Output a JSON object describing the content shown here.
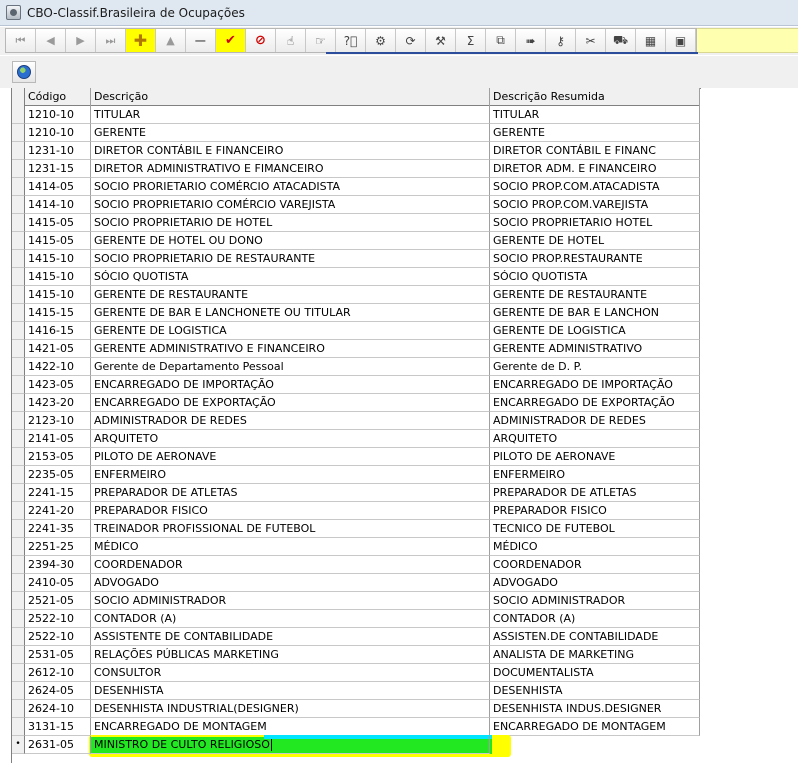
{
  "window": {
    "title": "CBO-Classif.Brasileira de Ocupações"
  },
  "toolbar": {
    "buttons": [
      {
        "icon": "first-record-icon",
        "glyph": "⏮",
        "cls": "nav"
      },
      {
        "icon": "prior-record-icon",
        "glyph": "◀",
        "cls": "nav"
      },
      {
        "icon": "next-record-icon",
        "glyph": "▶",
        "cls": "nav"
      },
      {
        "icon": "last-record-icon",
        "glyph": "⏭",
        "cls": "nav"
      },
      {
        "icon": "insert-record-icon",
        "glyph": "✚",
        "cls": "plus",
        "highlight": true
      },
      {
        "icon": "up-icon",
        "glyph": "▲",
        "cls": "nav"
      },
      {
        "icon": "delete-record-icon",
        "glyph": "−",
        "cls": "minus"
      },
      {
        "icon": "post-record-icon",
        "glyph": "✔",
        "cls": "red",
        "highlight": true
      },
      {
        "icon": "cancel-edit-icon",
        "glyph": "⊘",
        "cls": "red"
      },
      {
        "icon": "hand-pointer-icon",
        "glyph": "☝",
        "cls": "grey"
      },
      {
        "icon": "goto-record-icon",
        "glyph": "☞",
        "cls": "grey"
      },
      {
        "icon": "search-help-icon",
        "glyph": "?⃞",
        "cls": "grey"
      },
      {
        "icon": "filter-icon",
        "glyph": "⚙",
        "cls": "grey"
      },
      {
        "icon": "refresh-icon",
        "glyph": "⟳",
        "cls": "grey"
      },
      {
        "icon": "settings-icon",
        "glyph": "⚒",
        "cls": "grey"
      },
      {
        "icon": "sum-icon",
        "glyph": "Σ",
        "cls": "grey"
      },
      {
        "icon": "copy-icon",
        "glyph": "⧉",
        "cls": "grey"
      },
      {
        "icon": "export-icon",
        "glyph": "➠",
        "cls": "grey"
      },
      {
        "icon": "key-icon",
        "glyph": "⚷",
        "cls": "grey"
      },
      {
        "icon": "tools-icon",
        "glyph": "✂",
        "cls": "grey"
      },
      {
        "icon": "vehicle-icon",
        "glyph": "⛟",
        "cls": "grey"
      },
      {
        "icon": "calendar-icon",
        "glyph": "▦",
        "cls": "grey"
      },
      {
        "icon": "stop-icon",
        "glyph": "▣",
        "cls": "grey"
      }
    ]
  },
  "grid": {
    "headers": {
      "codigo": "Código",
      "descricao": "Descrição",
      "resumida": "Descrição Resumida"
    },
    "rows": [
      {
        "codigo": "1210-10",
        "descricao": "TITULAR",
        "resumida": "TITULAR"
      },
      {
        "codigo": "1210-10",
        "descricao": "GERENTE",
        "resumida": "GERENTE"
      },
      {
        "codigo": "1231-10",
        "descricao": "DIRETOR CONTÁBIL E FINANCEIRO",
        "resumida": "DIRETOR CONTÁBIL E FINANC"
      },
      {
        "codigo": "1231-15",
        "descricao": "DIRETOR ADMINISTRATIVO E FIMANCEIRO",
        "resumida": "DIRETOR ADM. E FINANCEIRO"
      },
      {
        "codigo": "1414-05",
        "descricao": "SOCIO PRORIETARIO COMÉRCIO ATACADISTA",
        "resumida": "SOCIO PROP.COM.ATACADISTA"
      },
      {
        "codigo": "1414-10",
        "descricao": "SOCIO PROPRIETARIO COMÉRCIO VAREJISTA",
        "resumida": "SOCIO PROP.COM.VAREJISTA"
      },
      {
        "codigo": "1415-05",
        "descricao": "SOCIO PROPRIETARIO DE HOTEL",
        "resumida": "SOCIO PROPRIETARIO  HOTEL"
      },
      {
        "codigo": "1415-05",
        "descricao": "GERENTE DE HOTEL OU DONO",
        "resumida": "GERENTE DE HOTEL"
      },
      {
        "codigo": "1415-10",
        "descricao": "SOCIO PROPRIETARIO DE RESTAURANTE",
        "resumida": "SOCIO PROP.RESTAURANTE"
      },
      {
        "codigo": "1415-10",
        "descricao": "SÓCIO QUOTISTA",
        "resumida": "SÓCIO QUOTISTA"
      },
      {
        "codigo": "1415-10",
        "descricao": "GERENTE DE RESTAURANTE",
        "resumida": "GERENTE DE RESTAURANTE"
      },
      {
        "codigo": "1415-15",
        "descricao": "GERENTE DE BAR E LANCHONETE OU TITULAR",
        "resumida": "GERENTE DE BAR E LANCHON"
      },
      {
        "codigo": "1416-15",
        "descricao": "GERENTE DE LOGISTICA",
        "resumida": "GERENTE DE LOGISTICA"
      },
      {
        "codigo": "1421-05",
        "descricao": "GERENTE ADMINISTRATIVO E FINANCEIRO",
        "resumida": "GERENTE ADMINISTRATIVO"
      },
      {
        "codigo": "1422-10",
        "descricao": "Gerente de Departamento Pessoal",
        "resumida": "Gerente de D. P."
      },
      {
        "codigo": "1423-05",
        "descricao": "ENCARREGADO DE IMPORTAÇÃO",
        "resumida": "ENCARREGADO DE IMPORTAÇÃO"
      },
      {
        "codigo": "1423-20",
        "descricao": "ENCARREGADO DE EXPORTAÇÃO",
        "resumida": "ENCARREGADO DE EXPORTAÇÃO"
      },
      {
        "codigo": "2123-10",
        "descricao": "ADMINISTRADOR DE REDES",
        "resumida": "ADMINISTRADOR DE REDES"
      },
      {
        "codigo": "2141-05",
        "descricao": "ARQUITETO",
        "resumida": "ARQUITETO"
      },
      {
        "codigo": "2153-05",
        "descricao": "PILOTO DE AERONAVE",
        "resumida": "PILOTO DE AERONAVE"
      },
      {
        "codigo": "2235-05",
        "descricao": "ENFERMEIRO",
        "resumida": "ENFERMEIRO"
      },
      {
        "codigo": "2241-15",
        "descricao": "PREPARADOR DE ATLETAS",
        "resumida": "PREPARADOR DE ATLETAS"
      },
      {
        "codigo": "2241-20",
        "descricao": "PREPARADOR FISICO",
        "resumida": "PREPARADOR FISICO"
      },
      {
        "codigo": "2241-35",
        "descricao": "TREINADOR PROFISSIONAL DE FUTEBOL",
        "resumida": "TECNICO DE FUTEBOL"
      },
      {
        "codigo": "2251-25",
        "descricao": "MÉDICO",
        "resumida": "MÉDICO"
      },
      {
        "codigo": "2394-30",
        "descricao": "COORDENADOR",
        "resumida": "COORDENADOR"
      },
      {
        "codigo": "2410-05",
        "descricao": "ADVOGADO",
        "resumida": "ADVOGADO"
      },
      {
        "codigo": "2521-05",
        "descricao": "SOCIO ADMINISTRADOR",
        "resumida": "SOCIO ADMINISTRADOR"
      },
      {
        "codigo": "2522-10",
        "descricao": "CONTADOR (A)",
        "resumida": "CONTADOR (A)"
      },
      {
        "codigo": "2522-10",
        "descricao": "ASSISTENTE DE CONTABILIDADE",
        "resumida": "ASSISTEN.DE CONTABILIDADE"
      },
      {
        "codigo": "2531-05",
        "descricao": "RELAÇÕES PÚBLICAS MARKETING",
        "resumida": "ANALISTA DE MARKETING"
      },
      {
        "codigo": "2612-10",
        "descricao": "CONSULTOR",
        "resumida": "DOCUMENTALISTA"
      },
      {
        "codigo": "2624-05",
        "descricao": "DESENHISTA",
        "resumida": "DESENHISTA"
      },
      {
        "codigo": "2624-10",
        "descricao": "DESENHISTA INDUSTRIAL(DESIGNER)",
        "resumida": "DESENHISTA INDUS.DESIGNER"
      },
      {
        "codigo": "3131-15",
        "descricao": "ENCARREGADO DE MONTAGEM",
        "resumida": "ENCARREGADO DE MONTAGEM"
      }
    ],
    "active_row": {
      "indicator": "•",
      "codigo": "2631-05",
      "descricao": "MINISTRO DE CULTO RELIGIOSO",
      "resumida": ""
    }
  }
}
